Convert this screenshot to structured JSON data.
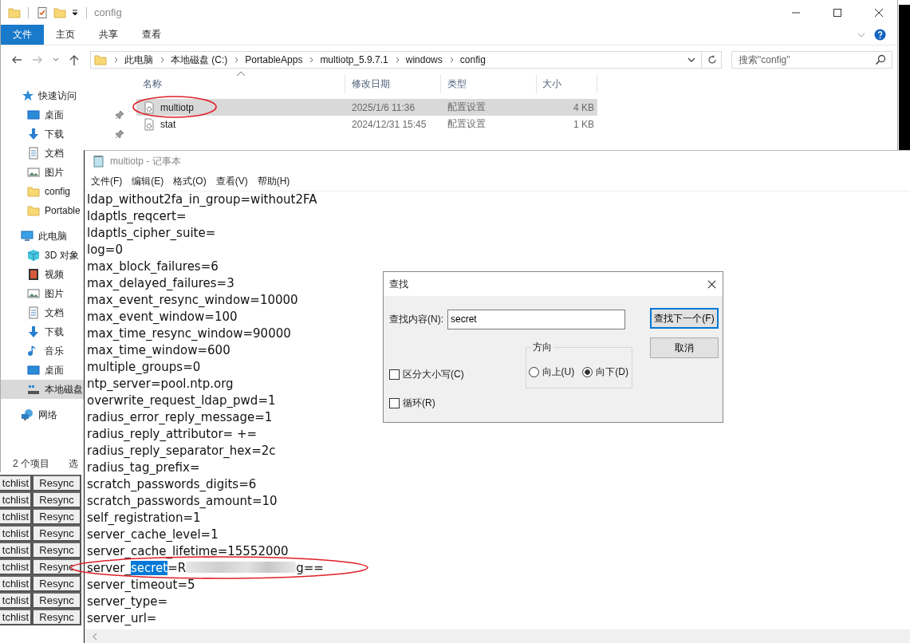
{
  "explorer": {
    "title": "config",
    "ribbon_tabs": [
      {
        "label": "文件",
        "selected": true
      },
      {
        "label": "主页",
        "selected": false
      },
      {
        "label": "共享",
        "selected": false
      },
      {
        "label": "查看",
        "selected": false
      }
    ],
    "breadcrumb": [
      "此电脑",
      "本地磁盘 (C:)",
      "PortableApps",
      "multiotp_5.9.7.1",
      "windows",
      "config"
    ],
    "search": {
      "placeholder": "搜索\"config\""
    },
    "sidebar": [
      {
        "label": "快速访问",
        "kind": "star",
        "selected": false,
        "children": [
          {
            "label": "桌面",
            "kind": "desktop",
            "pinned": true,
            "selected": false
          },
          {
            "label": "下载",
            "kind": "download",
            "pinned": true,
            "selected": false
          },
          {
            "label": "文档",
            "kind": "document",
            "pinned": false,
            "selected": false
          },
          {
            "label": "图片",
            "kind": "picture",
            "pinned": false,
            "selected": false
          },
          {
            "label": "config",
            "kind": "folder",
            "pinned": false,
            "selected": false
          },
          {
            "label": "Portable",
            "kind": "folder",
            "pinned": false,
            "selected": false
          }
        ]
      },
      {
        "label": "此电脑",
        "kind": "pc",
        "selected": false,
        "children": [
          {
            "label": "3D 对象",
            "kind": "cube",
            "selected": false
          },
          {
            "label": "视频",
            "kind": "video",
            "selected": false
          },
          {
            "label": "图片",
            "kind": "picture",
            "selected": false
          },
          {
            "label": "文档",
            "kind": "document",
            "selected": false
          },
          {
            "label": "下载",
            "kind": "download",
            "selected": false
          },
          {
            "label": "音乐",
            "kind": "music",
            "selected": false
          },
          {
            "label": "桌面",
            "kind": "desktop",
            "selected": false
          },
          {
            "label": "本地磁盘",
            "kind": "drive",
            "selected": true
          }
        ]
      },
      {
        "label": "网络",
        "kind": "network",
        "selected": false
      }
    ],
    "columns": [
      "名称",
      "修改日期",
      "类型",
      "大小"
    ],
    "files": [
      {
        "name": "multiotp",
        "date": "2025/1/6 11:36",
        "type": "配置设置",
        "size": "4 KB",
        "selected": true,
        "circled": true
      },
      {
        "name": "stat",
        "date": "2024/12/31 15:45",
        "type": "配置设置",
        "size": "1 KB",
        "selected": false,
        "circled": false
      }
    ],
    "status_bar": [
      "2 个项目",
      "选"
    ]
  },
  "background_table": {
    "rows": [
      [
        "tchlist",
        "Resync"
      ],
      [
        "tchlist",
        "Resync"
      ],
      [
        "tchlist",
        "Resync"
      ],
      [
        "tchlist",
        "Resync"
      ],
      [
        "tchlist",
        "Resync"
      ],
      [
        "tchlist",
        "Resync"
      ],
      [
        "tchlist",
        "Resync"
      ],
      [
        "tchlist",
        "Resync"
      ],
      [
        "tchlist",
        "Resync"
      ]
    ]
  },
  "notepad": {
    "title": "multiotp - 记事本",
    "menu": [
      "文件(F)",
      "编辑(E)",
      "格式(O)",
      "查看(V)",
      "帮助(H)"
    ],
    "lines": [
      {
        "kind": "plain",
        "text": "ldap_without2fa_in_group=without2FA"
      },
      {
        "kind": "plain",
        "text": "ldaptls_reqcert="
      },
      {
        "kind": "plain",
        "text": "ldaptls_cipher_suite="
      },
      {
        "kind": "plain",
        "text": "log=0"
      },
      {
        "kind": "plain",
        "text": "max_block_failures=6"
      },
      {
        "kind": "plain",
        "text": "max_delayed_failures=3"
      },
      {
        "kind": "plain",
        "text": "max_event_resync_window=10000"
      },
      {
        "kind": "plain",
        "text": "max_event_window=100"
      },
      {
        "kind": "plain",
        "text": "max_time_resync_window=90000"
      },
      {
        "kind": "plain",
        "text": "max_time_window=600"
      },
      {
        "kind": "plain",
        "text": "multiple_groups=0"
      },
      {
        "kind": "plain",
        "text": "ntp_server=pool.ntp.org"
      },
      {
        "kind": "plain",
        "text": "overwrite_request_ldap_pwd=1"
      },
      {
        "kind": "plain",
        "text": "radius_error_reply_message=1"
      },
      {
        "kind": "plain",
        "text": "radius_reply_attributor= +="
      },
      {
        "kind": "plain",
        "text": "radius_reply_separator_hex=2c"
      },
      {
        "kind": "plain",
        "text": "radius_tag_prefix="
      },
      {
        "kind": "plain",
        "text": "scratch_passwords_digits=6"
      },
      {
        "kind": "plain",
        "text": "scratch_passwords_amount=10"
      },
      {
        "kind": "plain",
        "text": "self_registration=1"
      },
      {
        "kind": "plain",
        "text": "server_cache_level=1"
      },
      {
        "kind": "plain",
        "text": "server_cache_lifetime=15552000"
      },
      {
        "kind": "match",
        "prefix": "server_",
        "match": "secret",
        "suffix": "=R",
        "redacted": true,
        "tail": "g==",
        "circled": true
      },
      {
        "kind": "plain",
        "text": "server_timeout=5"
      },
      {
        "kind": "plain",
        "text": "server_type="
      },
      {
        "kind": "plain",
        "text": "server_url="
      }
    ]
  },
  "find_dialog": {
    "title": "查找",
    "label": "查找内容(N):",
    "value": "secret",
    "buttons": [
      {
        "label": "查找下一个(F)",
        "default": true
      },
      {
        "label": "取消",
        "default": false
      }
    ],
    "options": [
      {
        "label": "区分大小写(C)",
        "checked": false
      },
      {
        "label": "循环(R)",
        "checked": false
      }
    ],
    "direction": {
      "title": "方向",
      "options": [
        {
          "label": "向上(U)",
          "selected": false
        },
        {
          "label": "向下(D)",
          "selected": true
        }
      ]
    }
  }
}
